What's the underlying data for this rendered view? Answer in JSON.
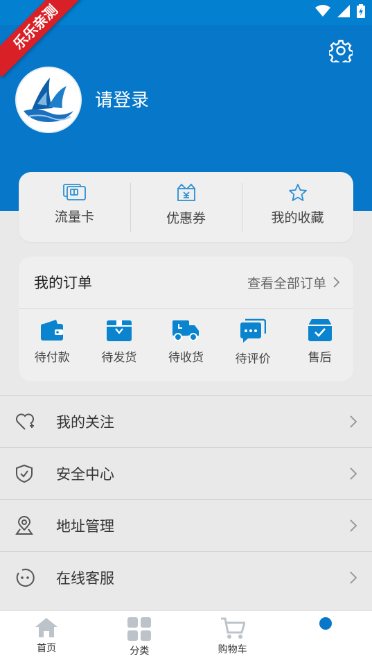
{
  "watermark": "乐乐亲测",
  "header": {
    "login_text": "请登录"
  },
  "quick_links": [
    {
      "icon": "sim-card-icon",
      "label": "流量卡"
    },
    {
      "icon": "coupon-icon",
      "label": "优惠券"
    },
    {
      "icon": "star-icon",
      "label": "我的收藏"
    }
  ],
  "orders": {
    "title": "我的订单",
    "view_all": "查看全部订单",
    "items": [
      {
        "icon": "wallet-icon",
        "label": "待付款"
      },
      {
        "icon": "package-icon",
        "label": "待发货"
      },
      {
        "icon": "truck-icon",
        "label": "待收货"
      },
      {
        "icon": "chat-icon",
        "label": "待评价"
      },
      {
        "icon": "after-sale-icon",
        "label": "售后"
      }
    ]
  },
  "menu": [
    {
      "icon": "heart-icon",
      "label": "我的关注"
    },
    {
      "icon": "shield-icon",
      "label": "安全中心"
    },
    {
      "icon": "location-icon",
      "label": "地址管理"
    },
    {
      "icon": "service-icon",
      "label": "在线客服"
    }
  ],
  "tabs": [
    {
      "icon": "home-icon",
      "label": "首页"
    },
    {
      "icon": "grid-icon",
      "label": "分类"
    },
    {
      "icon": "cart-icon",
      "label": "购物车"
    },
    {
      "icon": "profile-icon",
      "label": ""
    }
  ],
  "colors": {
    "primary": "#0677c9",
    "icon_blue": "#0a84cf",
    "page_bg": "#e9e9e9",
    "card_bg": "#efefef"
  }
}
